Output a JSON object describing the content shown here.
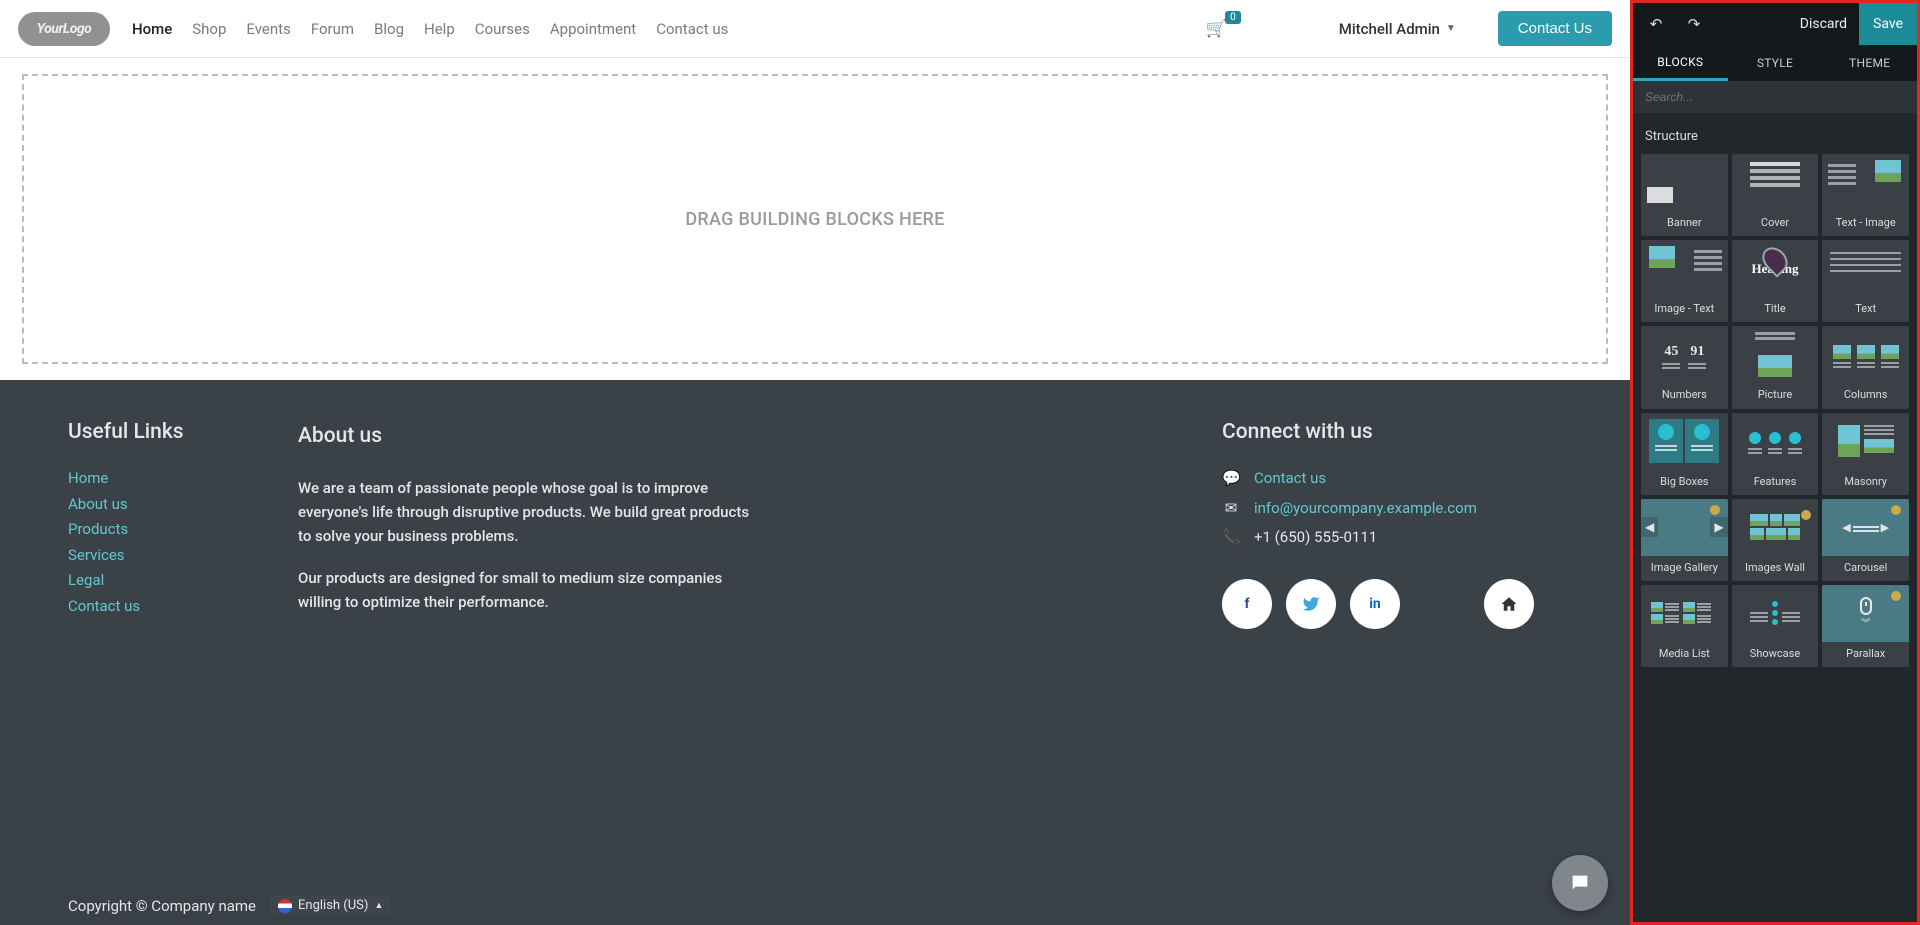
{
  "nav": {
    "logo": "YourLogo",
    "items": [
      "Home",
      "Shop",
      "Events",
      "Forum",
      "Blog",
      "Help",
      "Courses",
      "Appointment",
      "Contact us"
    ],
    "active_index": 0,
    "cart_count": "0",
    "user": "Mitchell Admin",
    "contact_btn": "Contact Us"
  },
  "canvas": {
    "drop_placeholder": "DRAG BUILDING BLOCKS HERE"
  },
  "footer": {
    "useful_title": "Useful Links",
    "useful_links": [
      "Home",
      "About us",
      "Products",
      "Services",
      "Legal",
      "Contact us"
    ],
    "about_title": "About us",
    "about_p1": "We are a team of passionate people whose goal is to improve everyone's life through disruptive products. We build great products to solve your business problems.",
    "about_p2": "Our products are designed for small to medium size companies willing to optimize their performance.",
    "connect_title": "Connect with us",
    "connect_contact": "Contact us",
    "connect_email": "info@yourcompany.example.com",
    "connect_phone": "+1 (650) 555-0111",
    "copyright": "Copyright © Company name",
    "language": "English (US)"
  },
  "editor": {
    "toolbar": {
      "discard": "Discard",
      "save": "Save"
    },
    "tabs": [
      "BLOCKS",
      "STYLE",
      "THEME"
    ],
    "active_tab": 0,
    "search_placeholder": "Search...",
    "section_structure": "Structure",
    "blocks": [
      "Banner",
      "Cover",
      "Text - Image",
      "Image - Text",
      "Title",
      "Text",
      "Numbers",
      "Picture",
      "Columns",
      "Big Boxes",
      "Features",
      "Masonry",
      "Image Gallery",
      "Images Wall",
      "Carousel",
      "Media List",
      "Showcase",
      "Parallax"
    ],
    "numbers_sample": [
      "45",
      "91"
    ]
  }
}
